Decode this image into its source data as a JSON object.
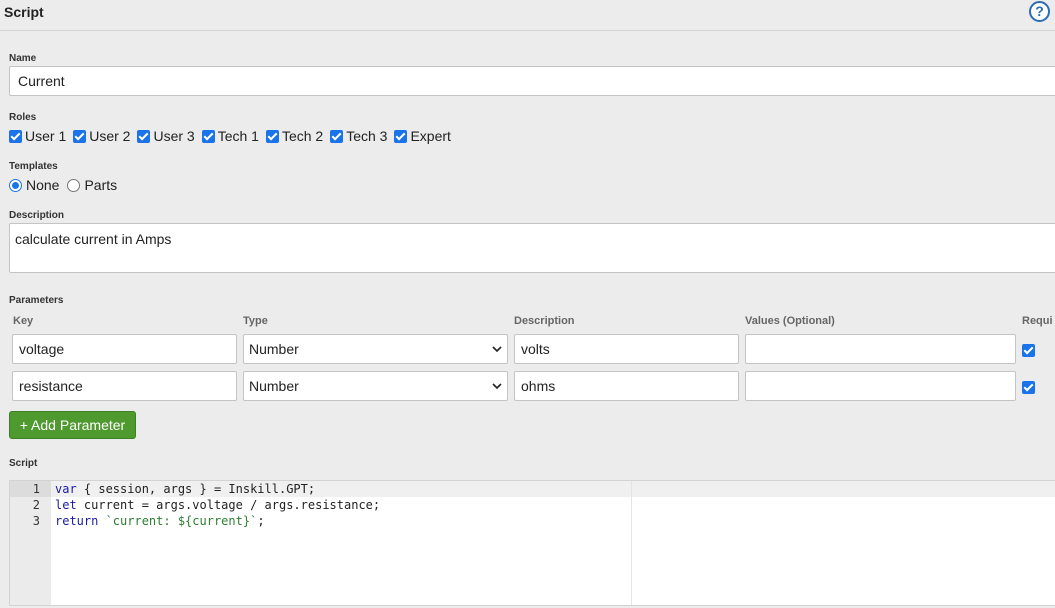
{
  "header": {
    "title": "Script",
    "help_glyph": "?"
  },
  "name": {
    "label": "Name",
    "value": "Current"
  },
  "roles": {
    "label": "Roles",
    "items": [
      "User 1",
      "User 2",
      "User 3",
      "Tech 1",
      "Tech 2",
      "Tech 3",
      "Expert"
    ]
  },
  "templates": {
    "label": "Templates",
    "options": [
      "None",
      "Parts"
    ],
    "selected": "None"
  },
  "description": {
    "label": "Description",
    "value": "calculate current in Amps"
  },
  "parameters": {
    "label": "Parameters",
    "columns": [
      "Key",
      "Type",
      "Description",
      "Values (Optional)",
      "Requi"
    ],
    "rows": [
      {
        "key": "voltage",
        "type": "Number",
        "description": "volts",
        "values": "",
        "required": true
      },
      {
        "key": "resistance",
        "type": "Number",
        "description": "ohms",
        "values": "",
        "required": true
      }
    ],
    "add_label": "+ Add Parameter"
  },
  "script": {
    "label": "Script",
    "line_numbers": [
      "1",
      "2",
      "3"
    ],
    "lines": [
      {
        "kw": "var",
        "rest": " { session, args } = Inskill.GPT;"
      },
      {
        "kw": "let",
        "rest": " current = args.voltage / args.resistance;"
      },
      {
        "kw": "return",
        "rest_str": " `current: ${current}`",
        "tail": ";"
      }
    ]
  },
  "colors": {
    "accent": "#1a73e8",
    "button": "#4e9a2f",
    "help": "#2a6db5"
  }
}
